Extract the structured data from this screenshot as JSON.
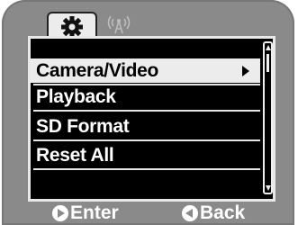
{
  "tabs": [
    {
      "icon": "gear-icon",
      "active": true
    },
    {
      "icon": "wireless-icon",
      "active": false
    }
  ],
  "menu": {
    "items": [
      {
        "label": "Camera/Video",
        "selected": true,
        "has_submenu": true
      },
      {
        "label": "Playback",
        "selected": false
      },
      {
        "label": "SD Format",
        "selected": false
      },
      {
        "label": "Reset All",
        "selected": false
      }
    ]
  },
  "footer": {
    "enter_label": "Enter",
    "back_label": "Back"
  },
  "colors": {
    "bezel": "#8a8a8a",
    "screen": "#000000",
    "highlight": "#ececec"
  }
}
